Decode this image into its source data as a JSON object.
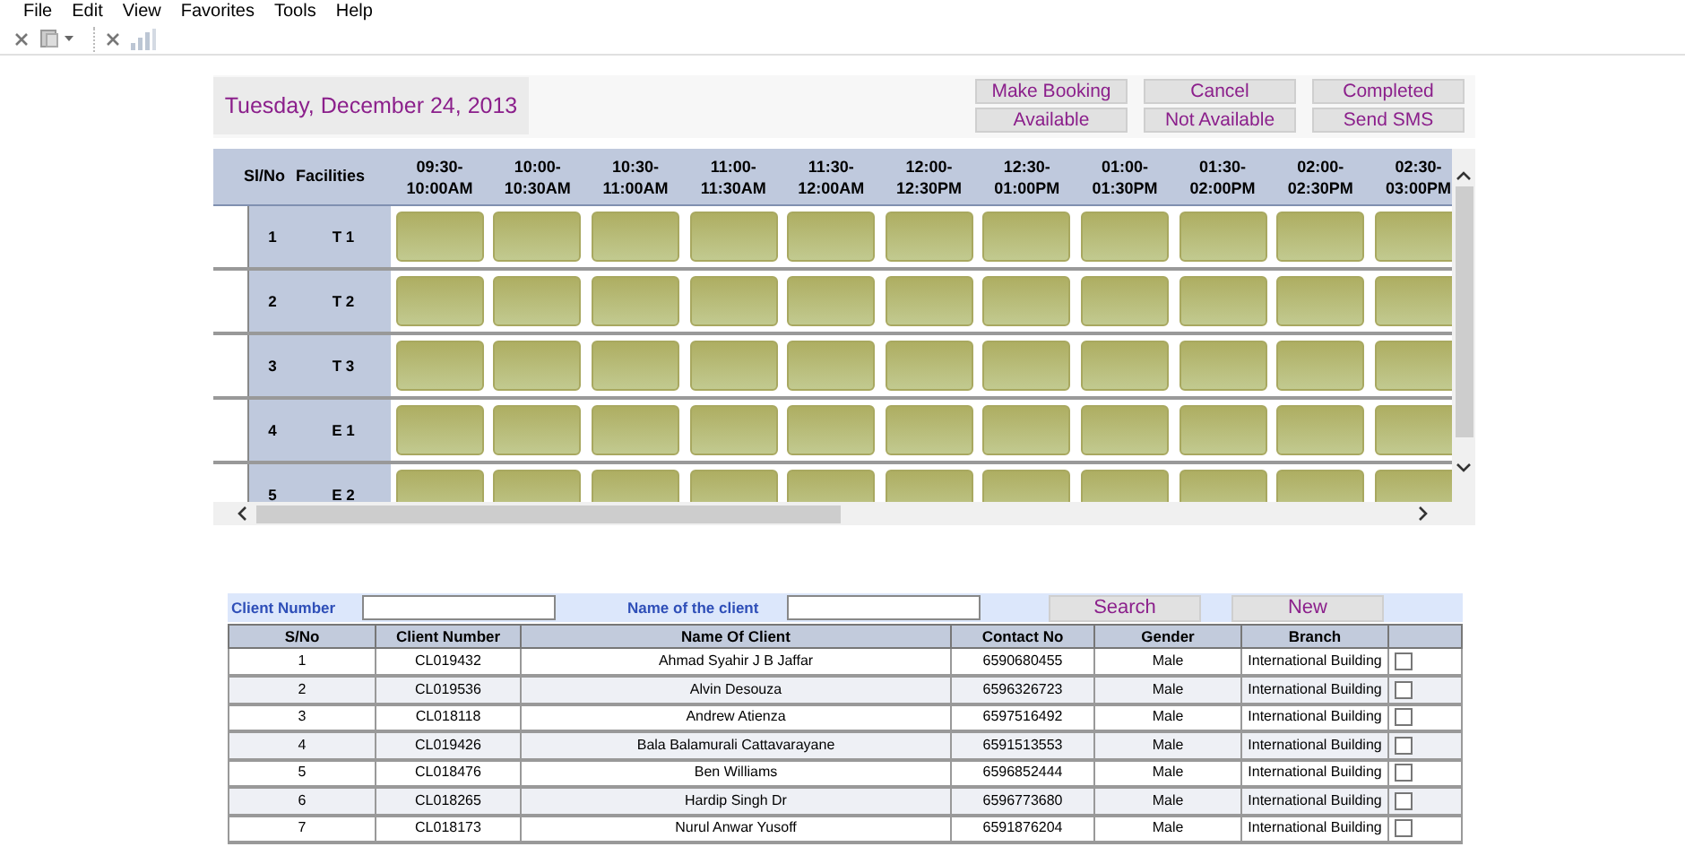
{
  "menu": [
    "File",
    "Edit",
    "View",
    "Favorites",
    "Tools",
    "Help"
  ],
  "date": "Tuesday, December 24, 2013",
  "actions": [
    [
      "Make Booking",
      "Available"
    ],
    [
      "Cancel",
      "Not Available"
    ],
    [
      "Completed",
      "Send SMS"
    ]
  ],
  "schedule": {
    "columns": [
      "Sl/No",
      "Facilities"
    ],
    "times": [
      {
        "start": "09:30-",
        "end": "10:00AM"
      },
      {
        "start": "10:00-",
        "end": "10:30AM"
      },
      {
        "start": "10:30-",
        "end": "11:00AM"
      },
      {
        "start": "11:00-",
        "end": "11:30AM"
      },
      {
        "start": "11:30-",
        "end": "12:00AM"
      },
      {
        "start": "12:00-",
        "end": "12:30PM"
      },
      {
        "start": "12:30-",
        "end": "01:00PM"
      },
      {
        "start": "01:00-",
        "end": "01:30PM"
      },
      {
        "start": "01:30-",
        "end": "02:00PM"
      },
      {
        "start": "02:00-",
        "end": "02:30PM"
      },
      {
        "start": "02:30-",
        "end": "03:00PM"
      }
    ],
    "rows": [
      {
        "no": "1",
        "facility": "T 1"
      },
      {
        "no": "2",
        "facility": "T 2"
      },
      {
        "no": "3",
        "facility": "T 3"
      },
      {
        "no": "4",
        "facility": "E 1"
      },
      {
        "no": "5",
        "facility": "E 2"
      }
    ]
  },
  "search": {
    "client_number_label": "Client Number",
    "client_name_label": "Name of the client",
    "buttons": [
      "Search",
      "New"
    ]
  },
  "clients": {
    "columns": [
      "S/No",
      "Client Number",
      "Name Of Client",
      "Contact No",
      "Gender",
      "Branch"
    ],
    "rows": [
      {
        "cells": [
          "1",
          "CL019432",
          "Ahmad Syahir J B Jaffar",
          "6590680455",
          "Male",
          "International Building"
        ],
        "checked": false
      },
      {
        "cells": [
          "2",
          "CL019536",
          "Alvin Desouza",
          "6596326723",
          "Male",
          "International Building"
        ],
        "checked": false
      },
      {
        "cells": [
          "3",
          "CL018118",
          "Andrew Atienza",
          "6597516492",
          "Male",
          "International Building"
        ],
        "checked": false
      },
      {
        "cells": [
          "4",
          "CL019426",
          "Bala Balamurali Cattavarayane",
          "6591513553",
          "Male",
          "International Building"
        ],
        "checked": false
      },
      {
        "cells": [
          "5",
          "CL018476",
          "Ben Williams",
          "6596852444",
          "Male",
          "International Building"
        ],
        "checked": false
      },
      {
        "cells": [
          "6",
          "CL018265",
          "Hardip Singh Dr",
          "6596773680",
          "Male",
          "International Building"
        ],
        "checked": false
      },
      {
        "cells": [
          "7",
          "CL018173",
          "Nurul Anwar Yusoff",
          "6591876204",
          "Male",
          "International Building"
        ],
        "checked": false
      }
    ]
  }
}
